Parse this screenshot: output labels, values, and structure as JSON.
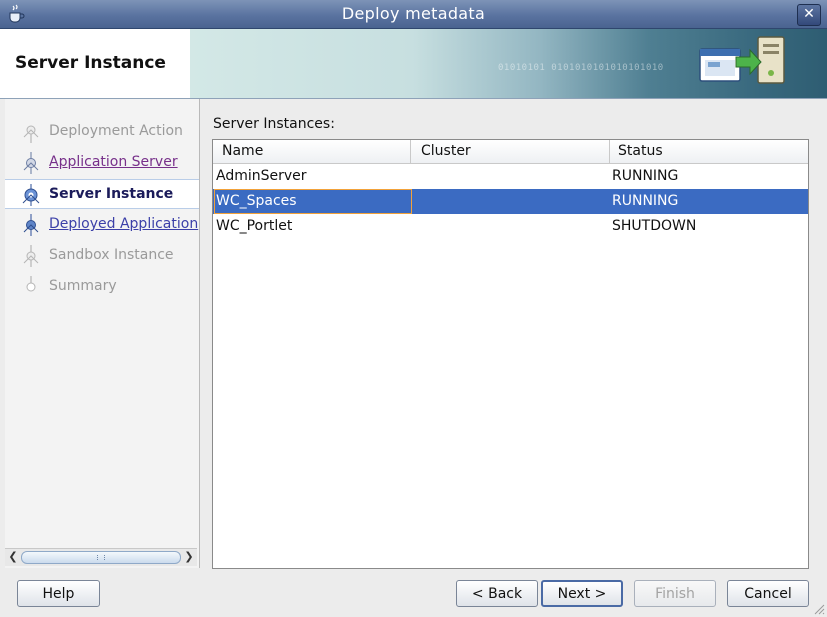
{
  "window": {
    "title": "Deploy metadata",
    "close_label": "✕"
  },
  "header": {
    "page_title": "Server Instance",
    "banner_binary": "01010101 0101010101010101010"
  },
  "nav": {
    "items": [
      {
        "label": "Deployment Action",
        "state": "disabled"
      },
      {
        "label": "Application Server",
        "state": "visited"
      },
      {
        "label": "Server Instance",
        "state": "current"
      },
      {
        "label": "Deployed Application",
        "state": "link"
      },
      {
        "label": "Sandbox Instance",
        "state": "disabled"
      },
      {
        "label": "Summary",
        "state": "disabled"
      }
    ]
  },
  "main": {
    "list_label": "Server Instances:",
    "table": {
      "columns": [
        "Name",
        "Cluster",
        "Status"
      ],
      "rows": [
        {
          "name": "AdminServer",
          "cluster": "",
          "status": "RUNNING",
          "selected": false
        },
        {
          "name": "WC_Spaces",
          "cluster": "",
          "status": "RUNNING",
          "selected": true
        },
        {
          "name": "WC_Portlet",
          "cluster": "",
          "status": "SHUTDOWN",
          "selected": false
        }
      ]
    }
  },
  "footer": {
    "help_label": "Help",
    "back_label": "< Back",
    "next_label": "Next >",
    "finish_label": "Finish",
    "cancel_label": "Cancel"
  },
  "colors": {
    "selection": "#3b6bc2",
    "focus_border": "#f2a23a",
    "visited_link": "#77308a",
    "link": "#3b3fa8"
  }
}
